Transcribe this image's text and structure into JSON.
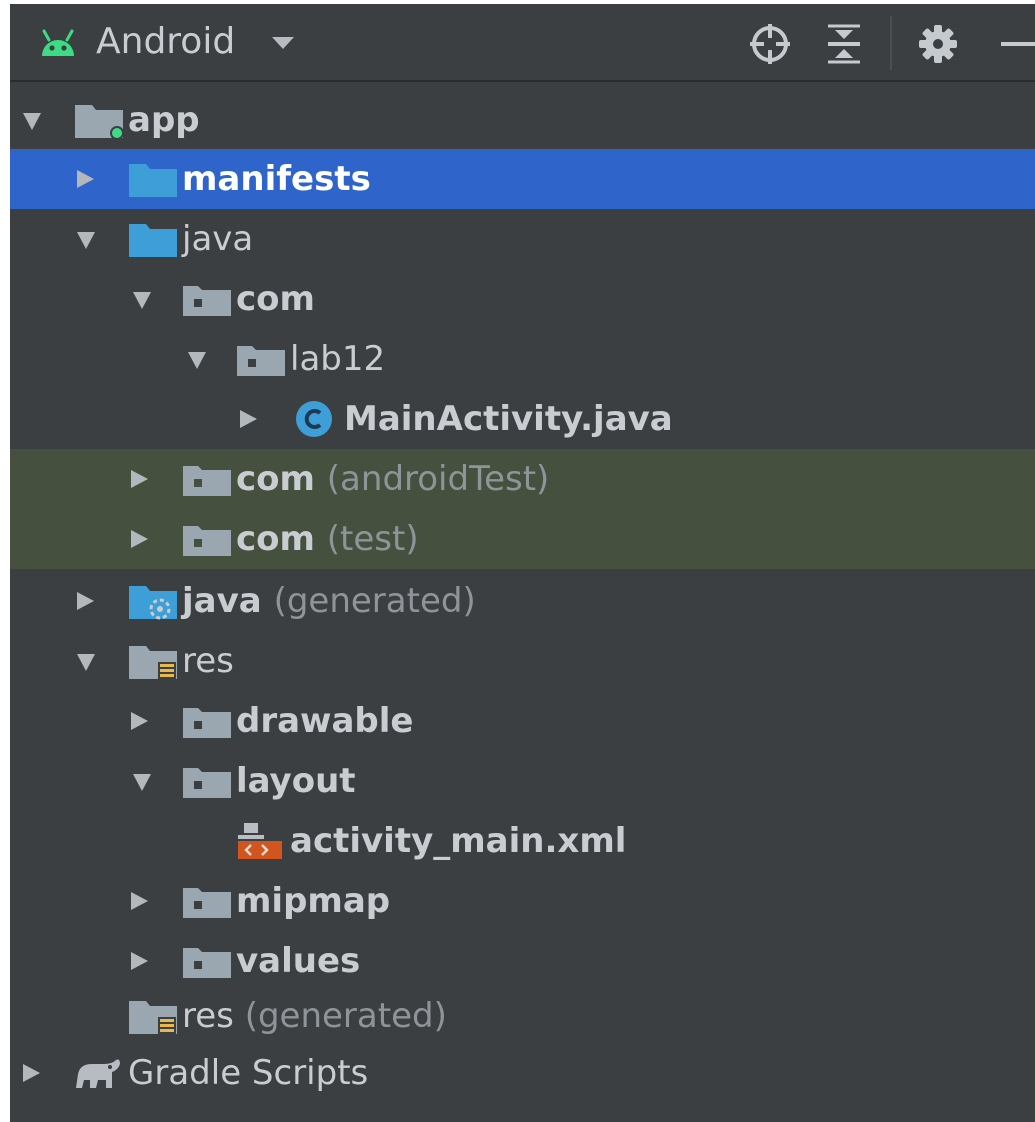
{
  "toolbar": {
    "title": "Android",
    "android_icon": "android-icon",
    "dropdown_icon": "triangle-down-icon",
    "buttons": [
      {
        "icon": "crosshair-locate-icon"
      },
      {
        "icon": "collapse-all-icon"
      },
      {
        "icon": "gear-icon"
      },
      {
        "icon": "minimize-icon"
      }
    ]
  },
  "tree": [
    {
      "label": "app",
      "suffix": "",
      "icon": "module-folder-icon",
      "expanded": true
    },
    {
      "label": "manifests",
      "suffix": "",
      "icon": "folder-icon",
      "expanded": false,
      "selected": true
    },
    {
      "label": "java",
      "suffix": "",
      "icon": "source-folder-icon",
      "expanded": true
    },
    {
      "label": "com",
      "suffix": "",
      "icon": "package-icon",
      "expanded": true
    },
    {
      "label": "lab12",
      "suffix": "",
      "icon": "package-icon",
      "expanded": true
    },
    {
      "label": "MainActivity.java",
      "suffix": "",
      "icon": "java-class-icon",
      "expanded": false
    },
    {
      "label": "com",
      "suffix": "(androidTest)",
      "icon": "package-icon",
      "expanded": false
    },
    {
      "label": "com",
      "suffix": "(test)",
      "icon": "package-icon",
      "expanded": false
    },
    {
      "label": "java",
      "suffix": "(generated)",
      "icon": "generated-source-folder-icon",
      "expanded": false
    },
    {
      "label": "res",
      "suffix": "",
      "icon": "resource-folder-icon",
      "expanded": true
    },
    {
      "label": "drawable",
      "suffix": "",
      "icon": "package-icon",
      "expanded": false
    },
    {
      "label": "layout",
      "suffix": "",
      "icon": "package-icon",
      "expanded": true
    },
    {
      "label": "activity_main.xml",
      "suffix": "",
      "icon": "layout-xml-file-icon"
    },
    {
      "label": "mipmap",
      "suffix": "",
      "icon": "package-icon",
      "expanded": false
    },
    {
      "label": "values",
      "suffix": "",
      "icon": "package-icon",
      "expanded": false
    },
    {
      "label": "res",
      "suffix": "(generated)",
      "icon": "resource-folder-icon"
    },
    {
      "label": "Gradle Scripts",
      "suffix": "",
      "icon": "gradle-elephant-icon",
      "expanded": false
    }
  ],
  "colors": {
    "panel_bg": "#3c3f41",
    "selection": "#2f65ca",
    "test_scope": "#45503f",
    "android_green": "#3ddc84",
    "folder_blue": "#3e9fd8",
    "package_gray": "#9aa7b0",
    "muted_text": "#8f9499",
    "xml_orange": "#d2541f",
    "resource_yellow": "#e8b84a"
  }
}
